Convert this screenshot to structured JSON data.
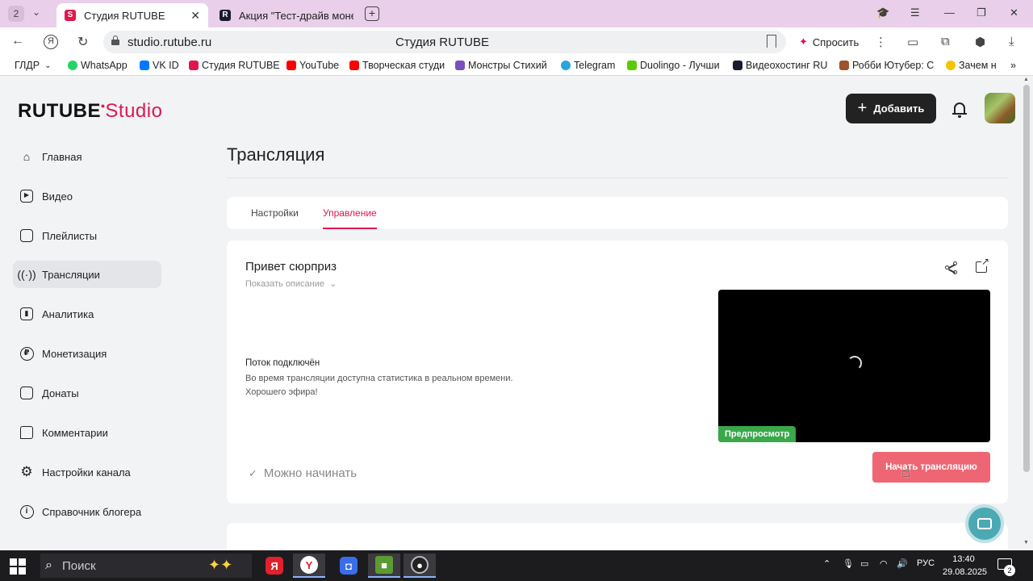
{
  "browser": {
    "tab_count": "2",
    "tabs": [
      {
        "favicon": "S",
        "title": "Студия RUTUBE"
      },
      {
        "favicon": "R",
        "title": "Акция \"Тест-драйв моне"
      }
    ],
    "url": "studio.rutube.ru",
    "page_title": "Студия RUTUBE",
    "ask_label": "Спросить",
    "bookmarks": [
      {
        "label": "ГЛДР",
        "color": "#00000000"
      },
      {
        "label": "WhatsApp",
        "color": "#25d366"
      },
      {
        "label": "VK ID",
        "color": "#0077ff"
      },
      {
        "label": "Студия RUTUBE",
        "color": "#e0174d"
      },
      {
        "label": "YouTube",
        "color": "#ff0000"
      },
      {
        "label": "Творческая студи",
        "color": "#ff0000"
      },
      {
        "label": "Монстры Стихий",
        "color": "#7a4fbf"
      },
      {
        "label": "Telegram",
        "color": "#2aa3e0"
      },
      {
        "label": "Duolingo - Лучши",
        "color": "#58cc02"
      },
      {
        "label": "Видеохостинг RU",
        "color": "#1a1a2e"
      },
      {
        "label": "Робби Ютубер: С",
        "color": "#a0522d"
      },
      {
        "label": "Зачем н",
        "color": "#f5c400"
      }
    ]
  },
  "header": {
    "logo_main": "RUTUBE",
    "logo_accent": "Studio",
    "add_label": "Добавить"
  },
  "sidebar": {
    "items": [
      {
        "label": "Главная",
        "icon": "home-icon"
      },
      {
        "label": "Видео",
        "icon": "video-icon"
      },
      {
        "label": "Плейлисты",
        "icon": "playlist-icon"
      },
      {
        "label": "Трансляции",
        "icon": "broadcast-icon"
      },
      {
        "label": "Аналитика",
        "icon": "analytics-icon"
      },
      {
        "label": "Монетизация",
        "icon": "ruble-icon"
      },
      {
        "label": "Донаты",
        "icon": "wallet-icon"
      },
      {
        "label": "Комментарии",
        "icon": "comment-icon"
      },
      {
        "label": "Настройки канала",
        "icon": "gear-icon"
      },
      {
        "label": "Справочник блогера",
        "icon": "info-icon"
      }
    ],
    "active_index": 3
  },
  "main": {
    "section_title": "Трансляция",
    "tabs": [
      {
        "label": "Настройки"
      },
      {
        "label": "Управление"
      }
    ],
    "stream_title": "Привет сюрприз",
    "show_description": "Показать описание",
    "status_heading": "Поток подключён",
    "status_lines": [
      "Во время трансляции доступна статистика в реальном времени.",
      "Хорошего эфира!"
    ],
    "preview_badge": "Предпросмотр",
    "ready_label": "Можно начинать",
    "start_button": "Начать трансляцию"
  },
  "taskbar": {
    "search_label": "Поиск",
    "lang": "РУС",
    "time": "13:40",
    "date": "29.08.2025",
    "notifications": "2"
  },
  "colors": {
    "accent": "#e0174d",
    "start_button": "#ee6673",
    "preview_badge": "#3aa74a"
  }
}
